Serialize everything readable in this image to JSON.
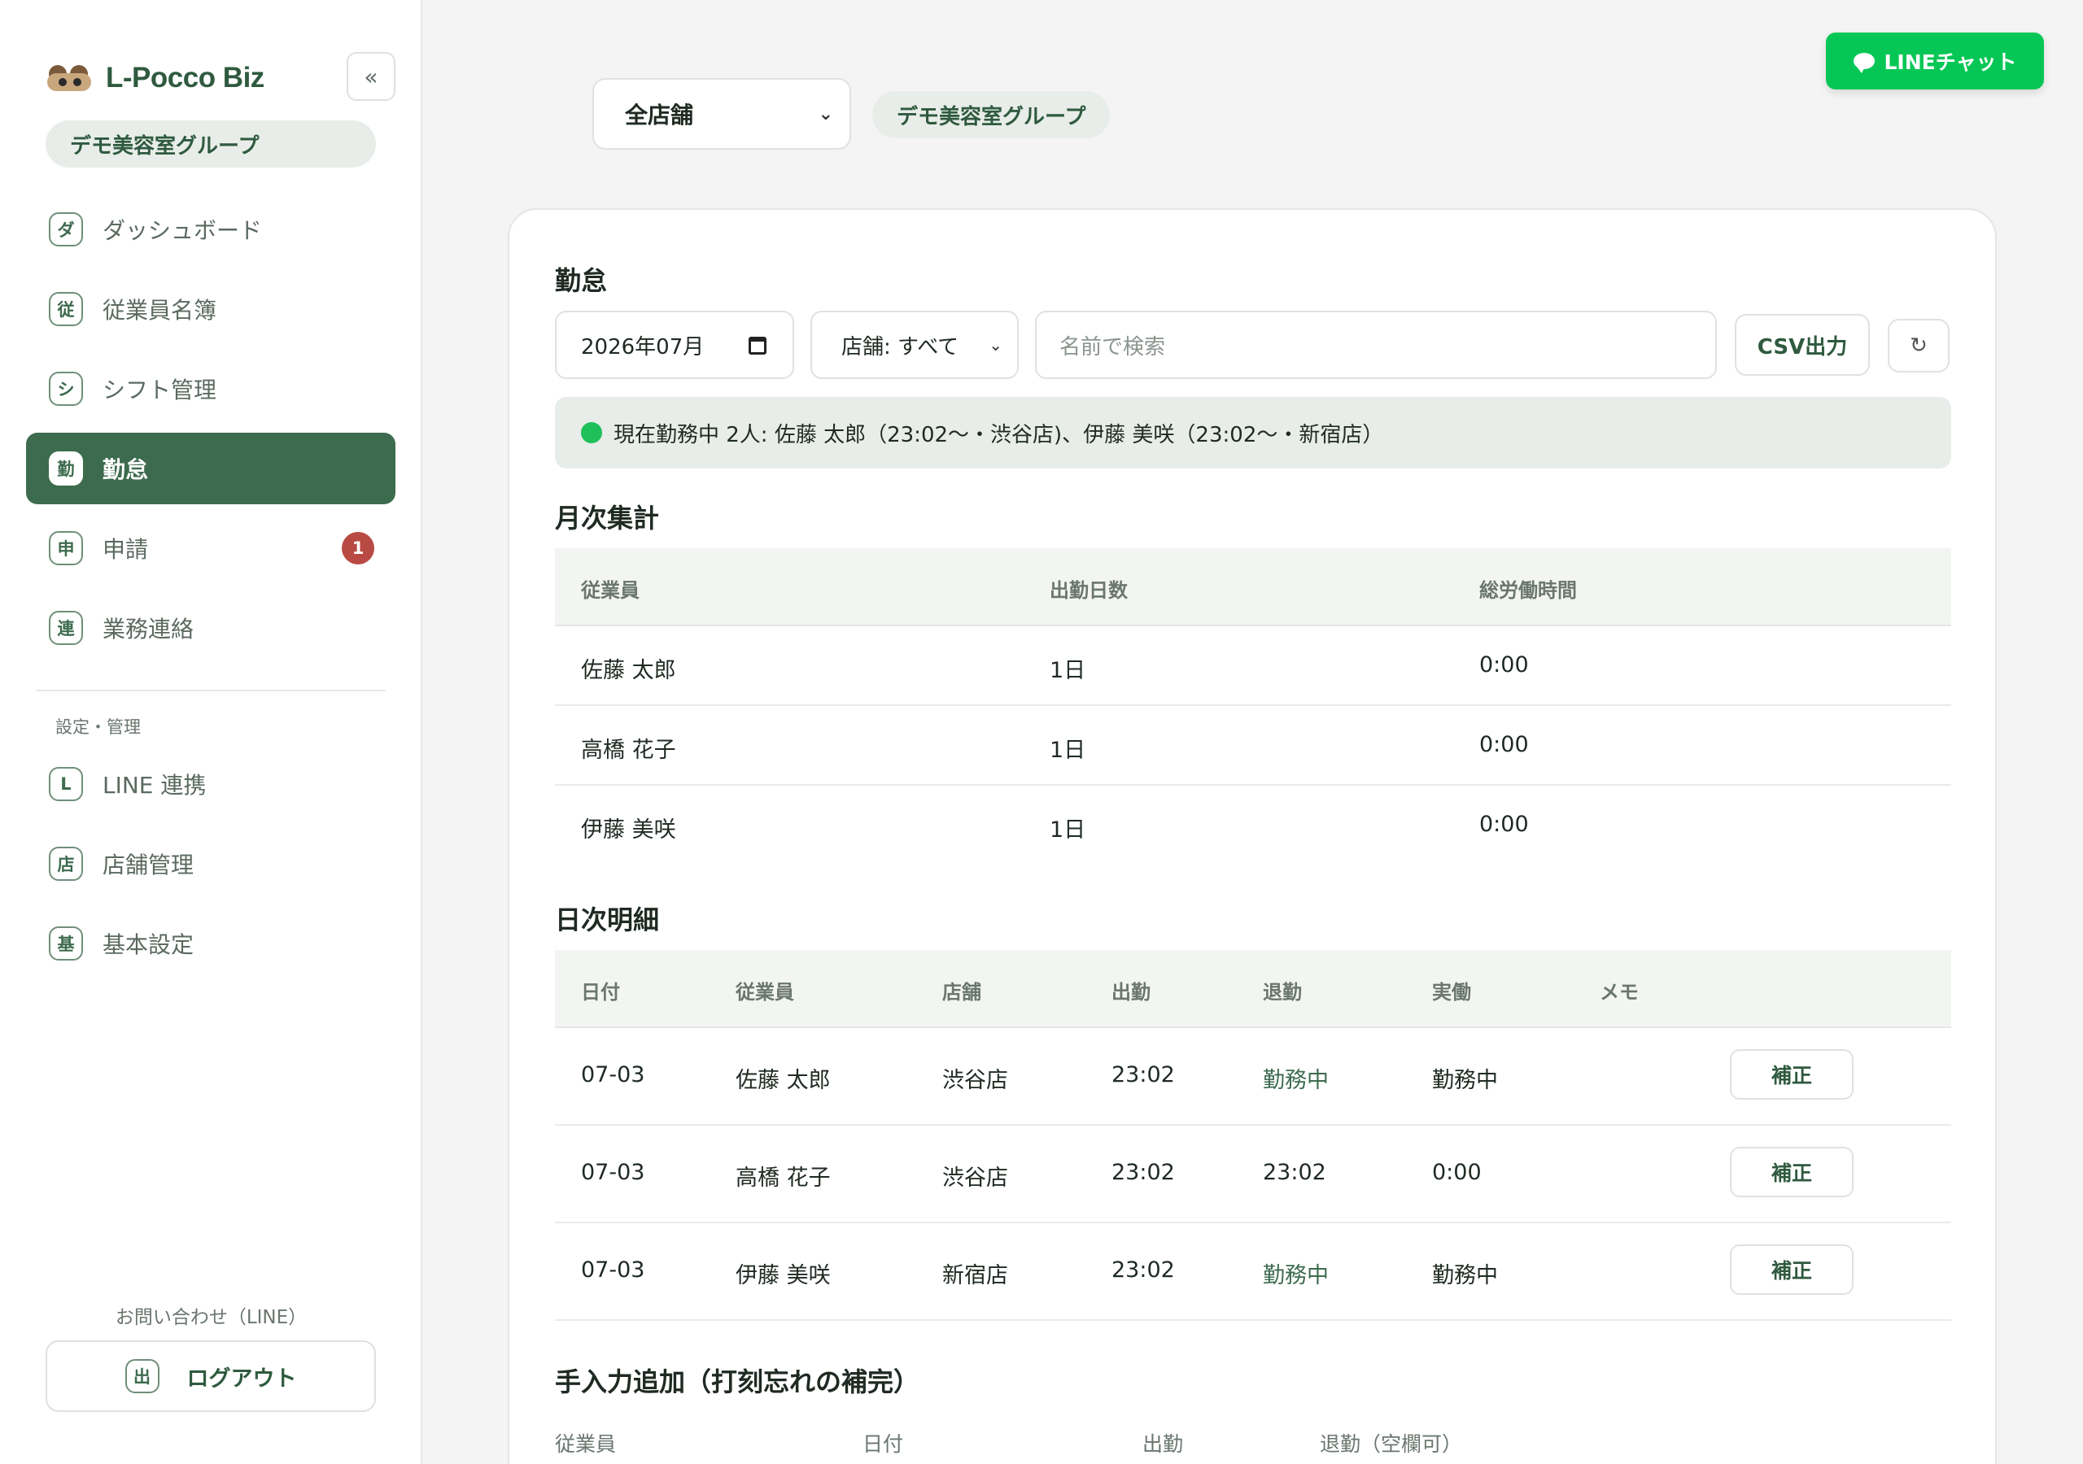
{
  "sidebar": {
    "brand": "L-Pocco Biz",
    "collapse": "«",
    "org": "デモ美容室グループ",
    "items": [
      {
        "icon": "ダ",
        "label": "ダッシュボード"
      },
      {
        "icon": "従",
        "label": "従業員名簿"
      },
      {
        "icon": "シ",
        "label": "シフト管理"
      },
      {
        "icon": "勤",
        "label": "勤怠"
      },
      {
        "icon": "申",
        "label": "申請",
        "badge": "1"
      },
      {
        "icon": "連",
        "label": "業務連絡"
      }
    ],
    "section": "設定・管理",
    "settings": [
      {
        "icon": "L",
        "label": "LINE 連携"
      },
      {
        "icon": "店",
        "label": "店舗管理"
      },
      {
        "icon": "基",
        "label": "基本設定"
      }
    ],
    "contact": "お問い合わせ（LINE）",
    "logout": {
      "icon": "出",
      "label": "ログアウト"
    }
  },
  "topbar": {
    "store_select": "全店舗",
    "group_chip": "デモ美容室グループ",
    "line_chat": "LINEチャット"
  },
  "attendance": {
    "title": "勤怠",
    "month": "2026年07月",
    "store_filter": "店舗: すべて",
    "search_placeholder": "名前で検索",
    "csv": "CSV出力",
    "refresh": "↻",
    "status": "現在勤務中 2人: 佐藤 太郎（23:02〜・渋谷店)、伊藤 美咲（23:02〜・新宿店）"
  },
  "monthly": {
    "title": "月次集計",
    "headers": [
      "従業員",
      "出勤日数",
      "総労働時間"
    ],
    "rows": [
      [
        "佐藤 太郎",
        "1日",
        "0:00"
      ],
      [
        "高橋 花子",
        "1日",
        "0:00"
      ],
      [
        "伊藤 美咲",
        "1日",
        "0:00"
      ]
    ]
  },
  "daily": {
    "title": "日次明細",
    "headers": [
      "日付",
      "従業員",
      "店舗",
      "出勤",
      "退勤",
      "実働",
      "メモ"
    ],
    "rows": [
      [
        "07-03",
        "佐藤 太郎",
        "渋谷店",
        "23:02",
        "勤務中",
        "勤務中",
        "",
        "補正"
      ],
      [
        "07-03",
        "高橋 花子",
        "渋谷店",
        "23:02",
        "23:02",
        "0:00",
        "",
        "補正"
      ],
      [
        "07-03",
        "伊藤 美咲",
        "新宿店",
        "23:02",
        "勤務中",
        "勤務中",
        "",
        "補正"
      ]
    ]
  },
  "manual": {
    "title": "手入力追加（打刻忘れの補完）",
    "labels": [
      "従業員",
      "日付",
      "出勤",
      "退勤（空欄可）"
    ]
  },
  "colors": {
    "accent": "#3d6b4e",
    "line_green": "#06c755",
    "badge_red": "#b94a43",
    "status_dot": "#1fc05a"
  }
}
